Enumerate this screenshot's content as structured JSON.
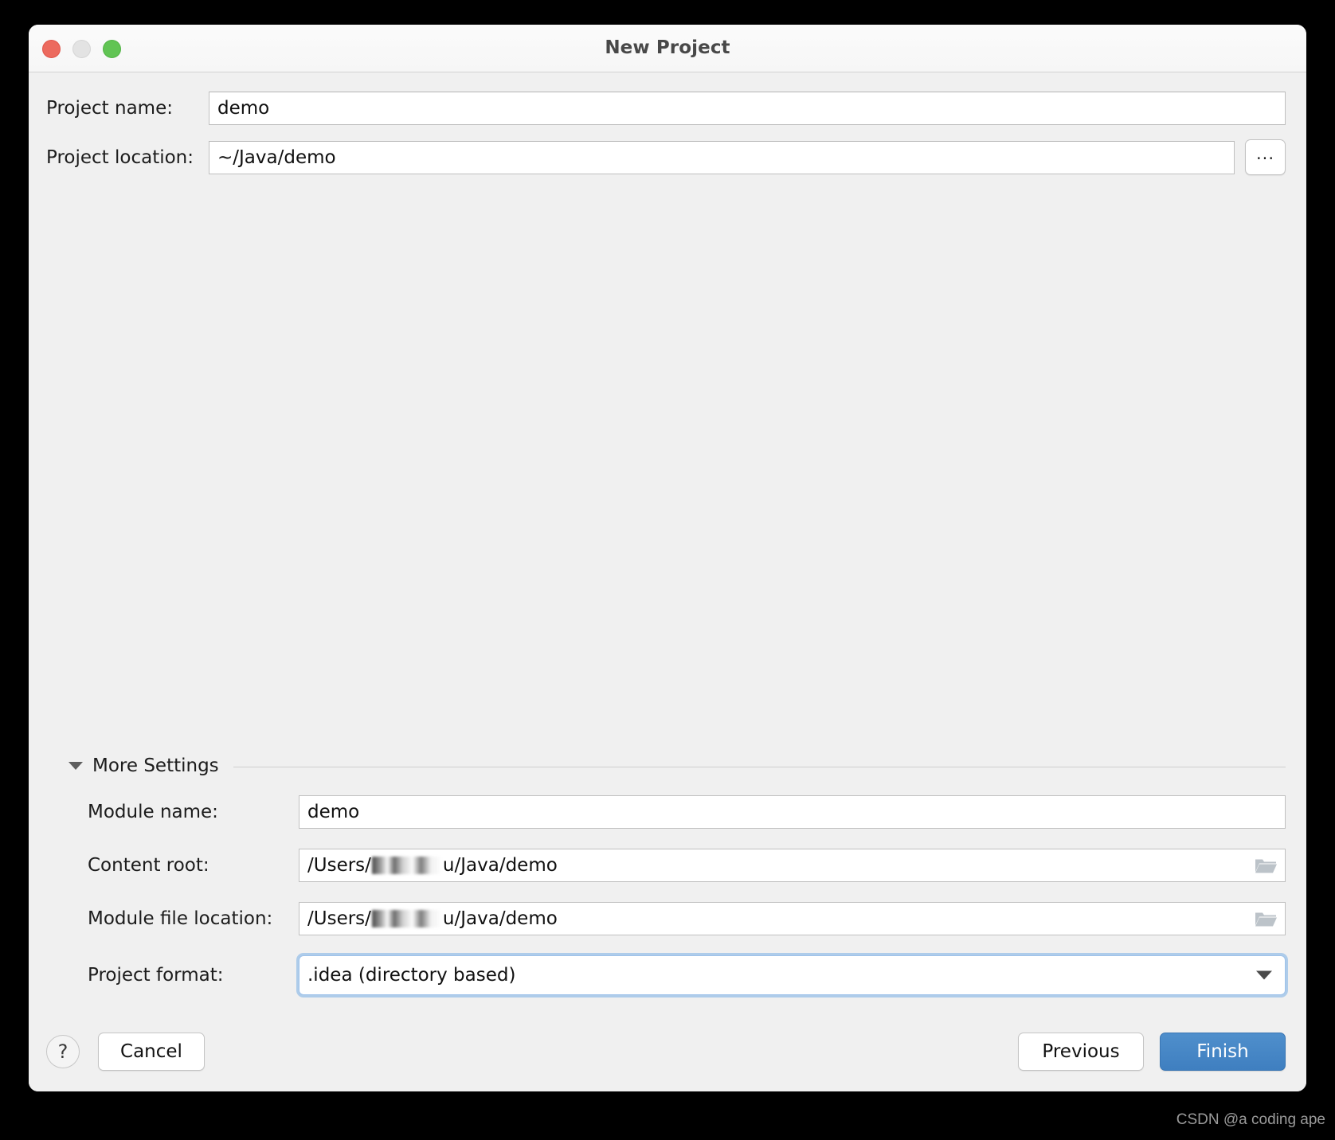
{
  "window": {
    "title": "New Project",
    "traffic_lights": {
      "close_color": "#ec6a5e",
      "minimize_color": "#e3e3e3",
      "zoom_color": "#61c454"
    }
  },
  "top_form": {
    "project_name": {
      "label": "Project name:",
      "value": "demo"
    },
    "project_location": {
      "label": "Project location:",
      "value": "~/Java/demo"
    },
    "browse_button_label": "..."
  },
  "more_settings": {
    "label": "More Settings",
    "expanded": true,
    "module_name": {
      "label": "Module name:",
      "value": "demo"
    },
    "content_root": {
      "label": "Content root:",
      "value_prefix": "/Users/",
      "value_suffix": "u/Java/demo"
    },
    "module_file_location": {
      "label": "Module file location:",
      "value_prefix": "/Users/",
      "value_suffix": "u/Java/demo"
    },
    "project_format": {
      "label": "Project format:",
      "value": ".idea (directory based)",
      "options": [
        ".idea (directory based)"
      ],
      "focus_color": "#7aafe6"
    }
  },
  "footer": {
    "help_label": "?",
    "cancel_label": "Cancel",
    "previous_label": "Previous",
    "finish_label": "Finish",
    "finish_color": "#4585c4"
  },
  "watermark": {
    "text": "CSDN @a coding ape"
  }
}
